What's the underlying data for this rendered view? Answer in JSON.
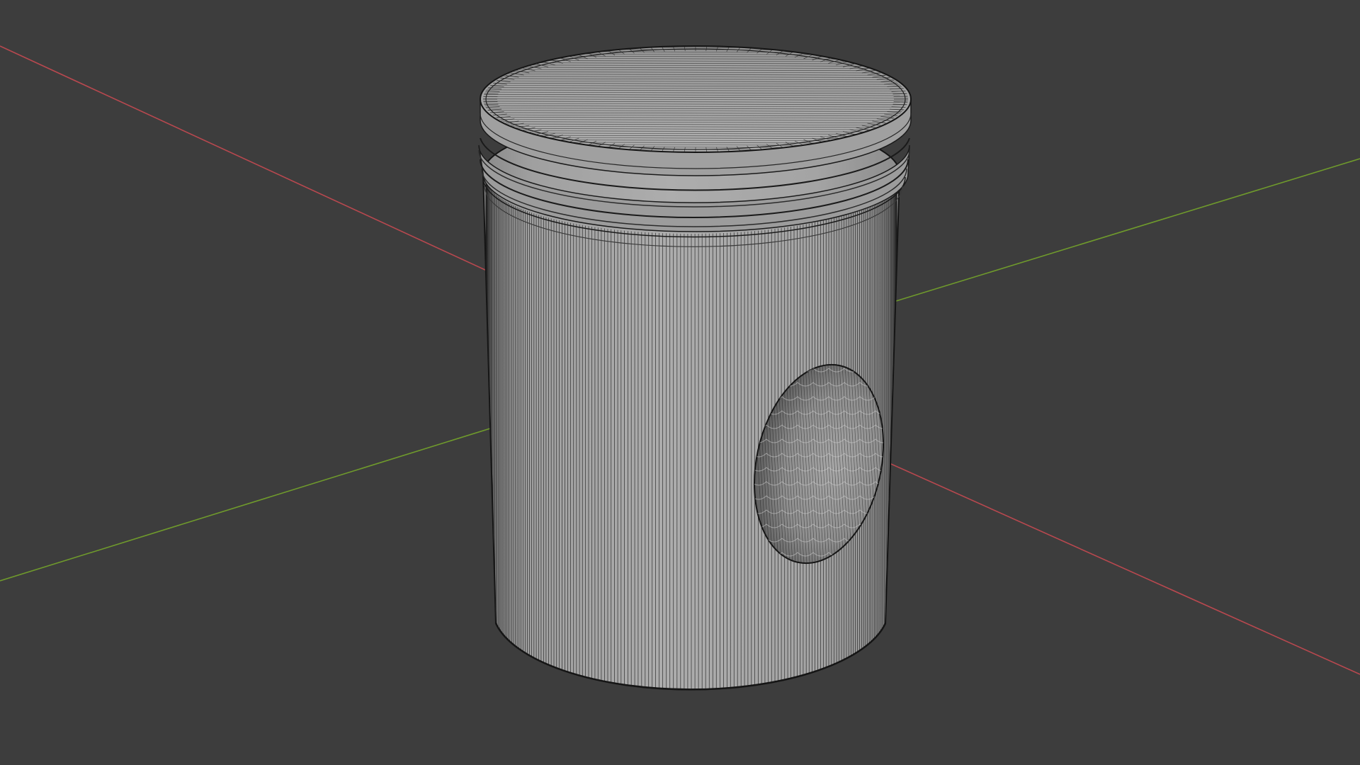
{
  "viewport": {
    "background_color": "#3d3d3d",
    "shading": "solid",
    "overlay": "wireframe"
  },
  "axes": {
    "x_axis_color": "#b8484f",
    "y_axis_color": "#6f9a2c"
  },
  "object": {
    "type": "piston",
    "surface_color": "#a6a6a6",
    "wire_color": "#1a1a1a",
    "features": [
      "piston-crown",
      "ring-grooves",
      "piston-skirt",
      "pin-bore"
    ]
  }
}
